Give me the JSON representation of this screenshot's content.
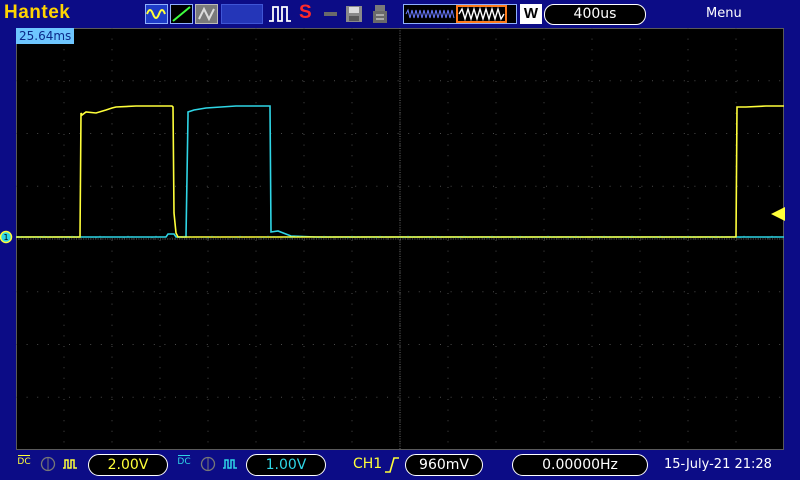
{
  "header": {
    "brand": "Hantek",
    "run_status": "S",
    "timebase": "400us",
    "memory_label": "W",
    "menu_label": "Menu",
    "icons": [
      "waveform-type-icon",
      "ramp-icon",
      "persist-icon",
      "pulse-icon",
      "save-disk-icon",
      "usb-storage-icon",
      "memory-waveform-icon"
    ]
  },
  "screen": {
    "cursor_time": "25.64ms"
  },
  "footer": {
    "ch1_coupling": "DC",
    "ch1_volts": "2.00V",
    "ch2_coupling": "DC",
    "ch2_volts": "1.00V",
    "trigger_source": "CH1",
    "trigger_level": "960mV",
    "frequency": "0.00000Hz",
    "datetime": "15-July-21 21:28"
  },
  "colors": {
    "ch1": "#ffff3a",
    "ch2": "#2fd6e6",
    "brand": "#ffd400",
    "background": "#0c0c86",
    "screen": "#000000"
  }
}
